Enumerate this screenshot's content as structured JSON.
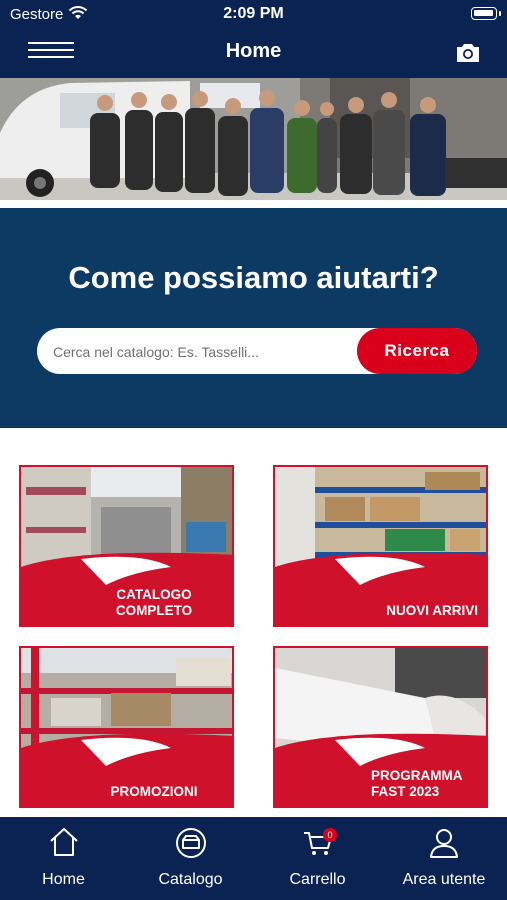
{
  "status_bar": {
    "carrier": "Gestore",
    "time": "2:09 PM"
  },
  "nav": {
    "title": "Home",
    "menu_icon": "hamburger-menu-icon",
    "camera_icon": "camera-icon"
  },
  "search": {
    "heading": "Come possiamo aiutarti?",
    "placeholder": "Cerca nel catalogo: Es. Tasselli...",
    "button_label": "Ricerca"
  },
  "tiles": [
    {
      "label_line1": "CATALOGO",
      "label_line2": "COMPLETO"
    },
    {
      "label_line1": "NUOVI ARRIVI",
      "label_line2": ""
    },
    {
      "label_line1": "PROMOZIONI",
      "label_line2": ""
    },
    {
      "label_line1": "PROGRAMMA",
      "label_line2": "FAST 2023"
    }
  ],
  "tabbar": [
    {
      "label": "Home",
      "icon": "home-icon"
    },
    {
      "label": "Catalogo",
      "icon": "catalog-icon"
    },
    {
      "label": "Carrello",
      "icon": "cart-icon",
      "badge": "0"
    },
    {
      "label": "Area utente",
      "icon": "user-icon"
    }
  ],
  "colors": {
    "navy": "#0b2352",
    "panel": "#0d3a62",
    "accent_red": "#d9001b"
  }
}
